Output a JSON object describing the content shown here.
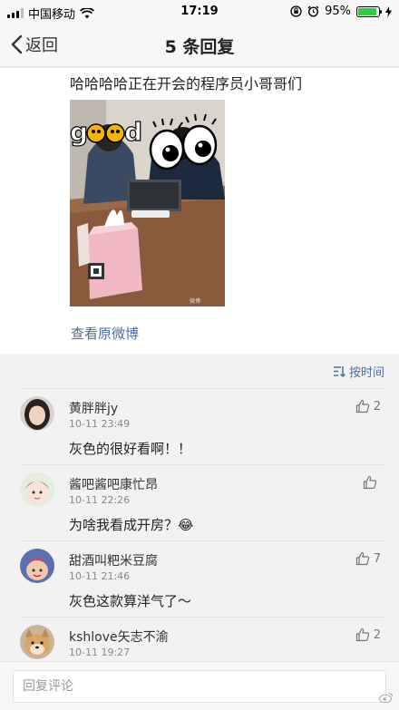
{
  "status_bar": {
    "carrier": "中国移动",
    "time": "17:19",
    "battery": "95%"
  },
  "nav": {
    "back_label": "返回",
    "title": "5 条回复"
  },
  "post": {
    "text": "哈哈哈哈正在开会的程序员小哥哥们",
    "image_caption_overlay": "good",
    "view_original": "查看原微博"
  },
  "sort": {
    "label": "按时间"
  },
  "comments": [
    {
      "name": "黄胖胖jy",
      "time": "10-11 23:49",
      "text": "灰色的很好看啊！！",
      "likes": "2"
    },
    {
      "name": "酱吧酱吧康忙昂",
      "time": "10-11 22:26",
      "text": "为啥我看成开房？😂",
      "likes": ""
    },
    {
      "name": "甜酒叫粑米豆腐",
      "time": "10-11 21:46",
      "text": "灰色这款算洋气了～",
      "likes": "7"
    },
    {
      "name": "kshlove矢志不渝",
      "time": "10-11 19:27",
      "text": "",
      "likes": "2"
    }
  ],
  "reply": {
    "placeholder": "回复评论"
  },
  "colors": {
    "link": "#4a6fa5",
    "battery": "#2ecc40"
  }
}
